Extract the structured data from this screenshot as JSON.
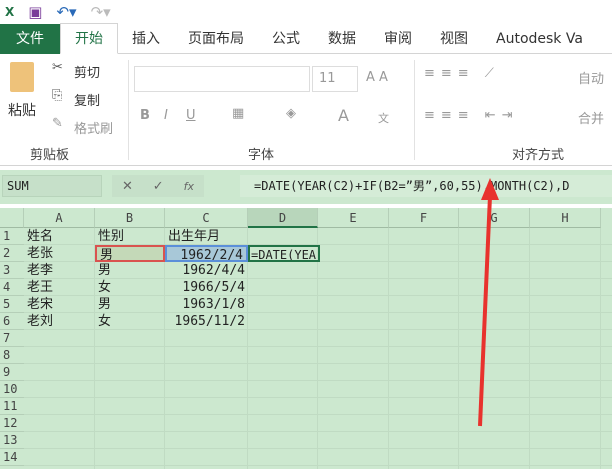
{
  "qat": {
    "excel_icon": "excel-icon",
    "save": "save-icon",
    "undo": "undo-icon",
    "redo": "redo-icon"
  },
  "tabs": [
    "文件",
    "开始",
    "插入",
    "页面布局",
    "公式",
    "数据",
    "审阅",
    "视图",
    "Autodesk Va"
  ],
  "ribbon": {
    "clipboard": {
      "paste": "粘贴",
      "cut": "剪切",
      "copy": "复制",
      "format_painter": "格式刷",
      "label": "剪贴板"
    },
    "font": {
      "size": "11",
      "bold": "B",
      "italic": "I",
      "underline": "U",
      "font_color": "A",
      "phonetic": "文",
      "label": "字体"
    },
    "alignment": {
      "wrap": "自动",
      "merge": "合并",
      "label": "对齐方式"
    }
  },
  "formula_bar": {
    "name_box": "SUM",
    "cancel": "✕",
    "enter": "✓",
    "fx": "fx",
    "formula": "=DATE(YEAR(C2)+IF(B2=”男”,60,55),MONTH(C2),D"
  },
  "columns": [
    "A",
    "B",
    "C",
    "D",
    "E",
    "F",
    "G",
    "H"
  ],
  "rows": [
    "1",
    "2",
    "3",
    "4",
    "5",
    "6",
    "7",
    "8",
    "9",
    "10",
    "11",
    "12",
    "13",
    "14"
  ],
  "cells": [
    [
      "姓名",
      "性别",
      "出生年月"
    ],
    [
      "老张",
      "男",
      "1962/2/4",
      "=DATE(YEA"
    ],
    [
      "老李",
      "男",
      "1962/4/4"
    ],
    [
      "老王",
      "女",
      "1966/5/4"
    ],
    [
      "老宋",
      "男",
      "1963/1/8"
    ],
    [
      "老刘",
      "女",
      "1965/11/2"
    ]
  ],
  "colors": {
    "accent": "#217346",
    "sheet_bg": "#cce8cf",
    "arrow": "#e8322d"
  }
}
